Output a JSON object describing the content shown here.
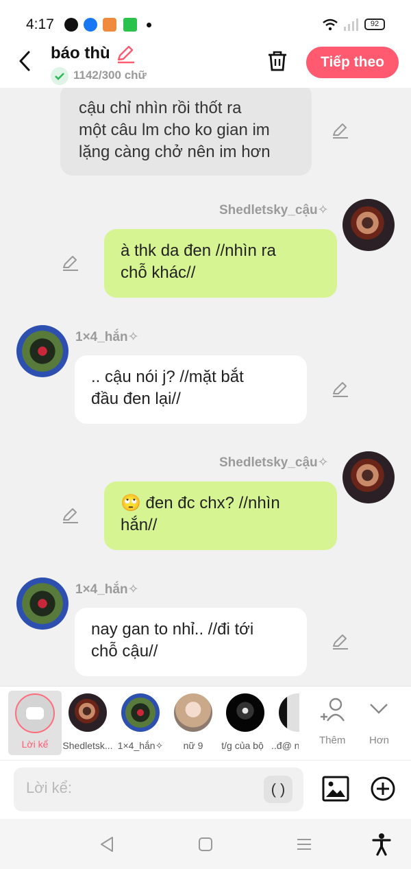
{
  "status_bar": {
    "time": "4:17",
    "battery": "92"
  },
  "header": {
    "title": "báo thù",
    "word_count": "1142/300 chữ",
    "next_label": "Tiếp theo"
  },
  "messages": [
    {
      "type": "narration",
      "text_lines": [
        "cậu chỉ nhìn rồi thốt ra",
        "một câu lm cho ko gian im",
        "lặng càng chở nên im hơn"
      ]
    },
    {
      "type": "right",
      "name": "Shedletsky_cậu✧",
      "text_lines": [
        "à thk da đen //nhìn ra",
        "chỗ khác//"
      ]
    },
    {
      "type": "left",
      "name": "1×4_hắn✧",
      "text_lines": [
        ".. cậu nói j? //mặt bắt",
        "đầu đen lại//"
      ]
    },
    {
      "type": "right",
      "name": "Shedletsky_cậu✧",
      "text_lines": [
        "🙄 đen đc chx? //nhìn",
        "hắn//"
      ]
    },
    {
      "type": "left",
      "name": "1×4_hắn✧",
      "text_lines": [
        "nay gan to nhỉ.. //đi tới",
        "chỗ cậu//"
      ]
    }
  ],
  "characters": {
    "narration_label": "Lời kể",
    "items": [
      {
        "label": "Shedletsk..."
      },
      {
        "label": "1×4_hắn✧"
      },
      {
        "label": "nữ 9"
      },
      {
        "label": "t/g của bộ"
      },
      {
        "label": "..đ@ nh"
      }
    ],
    "add_label": "Thêm",
    "more_label": "Hơn"
  },
  "input": {
    "placeholder": "Lời kể:",
    "paren_label": "( )"
  },
  "colors": {
    "accent": "#ff5a70",
    "green_bubble": "#d7f493",
    "grey_bubble": "#e6e6e6",
    "background": "#f1f1f1"
  }
}
